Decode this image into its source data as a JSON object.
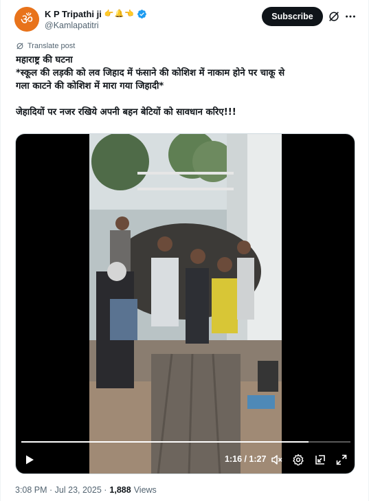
{
  "author": {
    "name": "K P Tripathi ji",
    "emojis": [
      "👉",
      "🔔",
      "👈"
    ],
    "handle": "@Kamlapatitri"
  },
  "header": {
    "subscribe_label": "Subscribe"
  },
  "translate_label": "Translate post",
  "tweet": {
    "line1": "महाराष्ट्र की घटना",
    "line2": "*स्कूल की लड़की को लव जिहाद में फंसाने की कोशिश में नाकाम होने पर चाकू से",
    "line3": "गला काटने की कोशिश में मारा गया जिहादी*",
    "line4": "जेहादियों पर नजर रखिये अपनी बहन बेटियों को सावधान करिए!!!"
  },
  "video": {
    "time": "1:16 / 1:27",
    "progress": 0.873
  },
  "footer": {
    "time": "3:08 PM · Jul 23, 2025 ·",
    "views_count": "1,888",
    "views_label": "Views"
  },
  "colors": {
    "avatar_bg": "#e8731b",
    "verified": "#1d9bf0",
    "subscribe_bg": "#0f1419"
  }
}
